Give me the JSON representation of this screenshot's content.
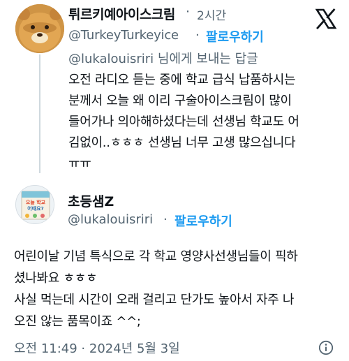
{
  "reply_tweet": {
    "display_name": "튀르키예아이스크림",
    "separator": "·",
    "time_ago": "2시간",
    "handle": "@TurkeyTurkeyice",
    "handle_separator": "·",
    "follow_label": "팔로우하기",
    "reply_to_mention": "@lukalouisriri",
    "reply_to_suffix": " 님에게 보내는 답글",
    "body_lines": [
      "오전 라디오 듣는 중에 학교 급식 납품하시는",
      "분께서 오늘 왜 이리 구술아이스크림이 많이",
      "들어가나 의아해하셨다는데 선생님 학교도 어",
      "김없이..ㅎㅎㅎ 선생님 너무 고생 많으십니다",
      "ㅠㅠ"
    ],
    "avatar_icon": "bear-character-avatar"
  },
  "main_tweet": {
    "display_name": "초등샘Z",
    "handle": "@lukalouisriri",
    "handle_separator": "·",
    "follow_label": "팔로우하기",
    "body_lines": [
      "어린이날 기념 특식으로 각 학교 영양사선생님들이 픽하",
      "셨나봐요 ㅎㅎㅎ",
      "사실 먹는데 시간이 오래 걸리고 단가도 높아서 자주 나",
      "오진 않는 품목이죠 ^^;"
    ],
    "timestamp": "오전 11:49 · 2024년 5월 3일",
    "avatar_icon": "book-cover-avatar",
    "avatar_book_text": "오늘 학교 어때요?"
  },
  "icons": {
    "platform_logo": "x-logo-icon",
    "info": "info-icon"
  },
  "colors": {
    "link_blue": "#1d9bf0",
    "secondary_text": "#536471",
    "primary_text": "#0f1419"
  }
}
